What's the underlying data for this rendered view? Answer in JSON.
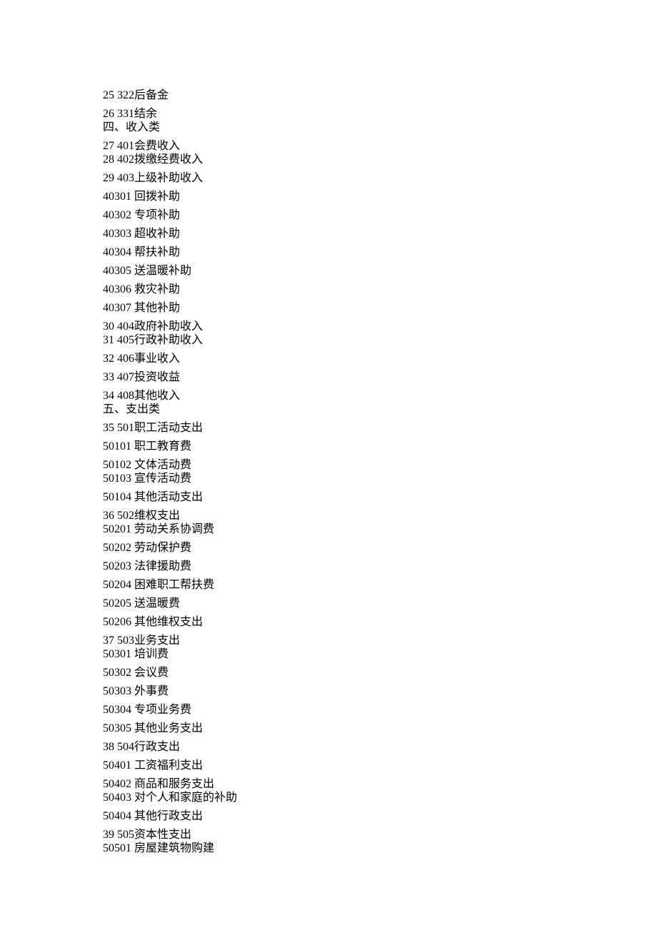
{
  "lines": [
    {
      "cls": "sp",
      "text": "25 322后备金"
    },
    {
      "cls": "sp",
      "text": "26 331结余"
    },
    {
      "cls": "sm",
      "text": "四、收入类"
    },
    {
      "cls": "sp",
      "text": "27 401会费收入"
    },
    {
      "cls": "sm",
      "text": "28 402拨缴经费收入"
    },
    {
      "cls": "sp",
      "text": "29 403上级补助收入"
    },
    {
      "cls": "sp",
      "text": "40301 回拨补助"
    },
    {
      "cls": "sp",
      "text": "40302 专项补助"
    },
    {
      "cls": "sp",
      "text": "40303 超收补助"
    },
    {
      "cls": "sp",
      "text": "40304 帮扶补助"
    },
    {
      "cls": "sp",
      "text": "40305 送温暖补助"
    },
    {
      "cls": "sp",
      "text": "40306 救灾补助"
    },
    {
      "cls": "sp",
      "text": "40307 其他补助"
    },
    {
      "cls": "sp",
      "text": "30 404政府补助收入"
    },
    {
      "cls": "sm",
      "text": "31 405行政补助收入"
    },
    {
      "cls": "sp",
      "text": "32 406事业收入"
    },
    {
      "cls": "sp",
      "text": "33 407投资收益"
    },
    {
      "cls": "sp",
      "text": "34 408其他收入"
    },
    {
      "cls": "sm",
      "text": "五、支出类"
    },
    {
      "cls": "sp",
      "text": "35 501职工活动支出"
    },
    {
      "cls": "sp",
      "text": "50101 职工教育费"
    },
    {
      "cls": "sp",
      "text": "50102 文体活动费"
    },
    {
      "cls": "sm",
      "text": "50103 宣传活动费"
    },
    {
      "cls": "sp",
      "text": "50104 其他活动支出"
    },
    {
      "cls": "sp",
      "text": "36 502维权支出"
    },
    {
      "cls": "sm",
      "text": "50201 劳动关系协调费"
    },
    {
      "cls": "sp",
      "text": "50202 劳动保护费"
    },
    {
      "cls": "sp",
      "text": "50203 法律援助费"
    },
    {
      "cls": "sp",
      "text": "50204 困难职工帮扶费"
    },
    {
      "cls": "sp",
      "text": "50205 送温暖费"
    },
    {
      "cls": "sp",
      "text": "50206 其他维权支出"
    },
    {
      "cls": "sp",
      "text": "37 503业务支出"
    },
    {
      "cls": "sm",
      "text": "50301 培训费"
    },
    {
      "cls": "sp",
      "text": "50302 会议费"
    },
    {
      "cls": "sp",
      "text": "50303 外事费"
    },
    {
      "cls": "sp",
      "text": "50304 专项业务费"
    },
    {
      "cls": "sp",
      "text": "50305 其他业务支出"
    },
    {
      "cls": "sp",
      "text": "38 504行政支出"
    },
    {
      "cls": "sp",
      "text": "50401 工资福利支出"
    },
    {
      "cls": "sp",
      "text": "50402 商品和服务支出"
    },
    {
      "cls": "sm",
      "text": "50403 对个人和家庭的补助"
    },
    {
      "cls": "sp",
      "text": "50404 其他行政支出"
    },
    {
      "cls": "sp",
      "text": "39 505资本性支出"
    },
    {
      "cls": "sm",
      "text": "50501 房屋建筑物购建"
    }
  ]
}
